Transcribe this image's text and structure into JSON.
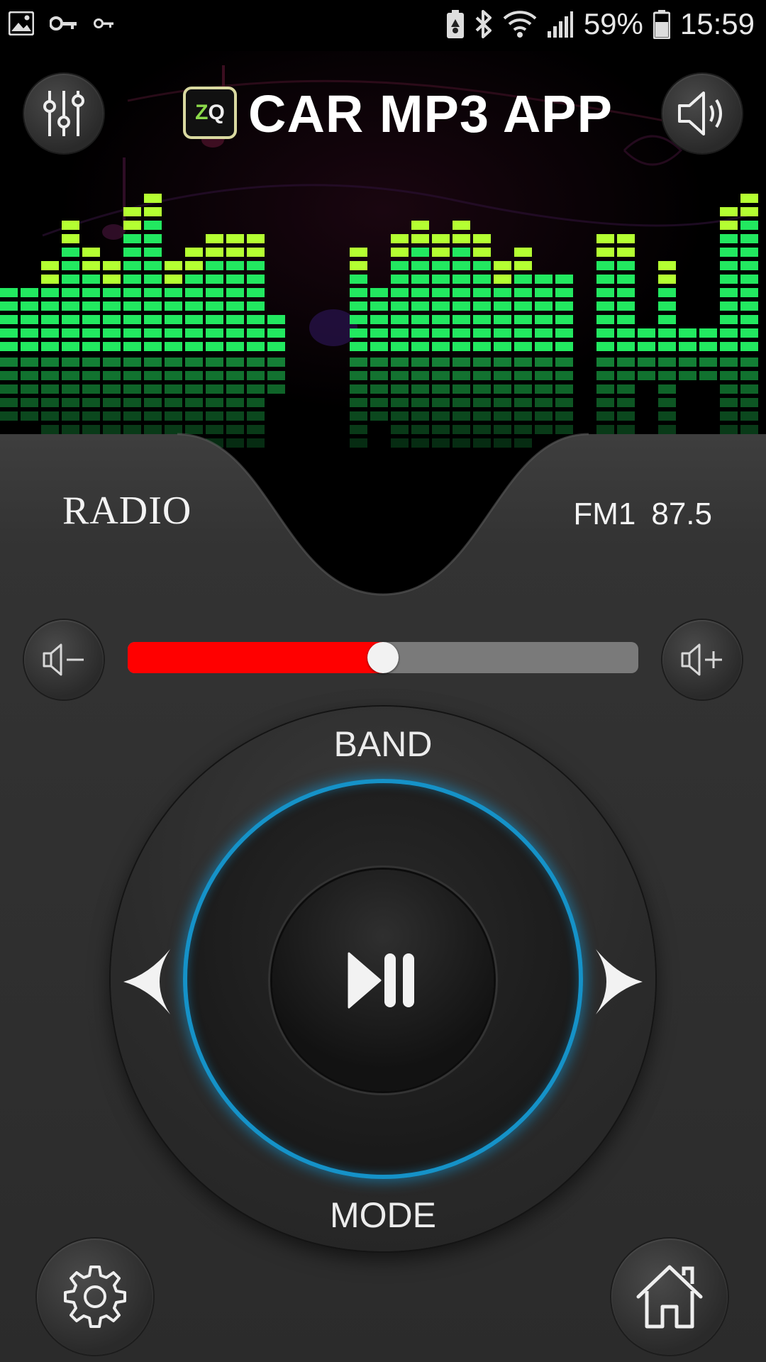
{
  "status_bar": {
    "battery_percent": "59%",
    "time": "15:59",
    "icons": [
      "image-icon",
      "key-icon",
      "key-small-icon",
      "battery-saver-icon",
      "bluetooth-icon",
      "wifi-icon",
      "signal-icon",
      "battery-icon"
    ]
  },
  "header": {
    "logo_z": "Z",
    "logo_q": "Q",
    "title": "CAR MP3 APP",
    "left_icon": "equalizer-icon",
    "right_icon": "speaker-icon"
  },
  "source": {
    "label": "RADIO",
    "band": "FM1",
    "frequency": "87.5"
  },
  "volume": {
    "level": 0.5,
    "down_icon": "volume-down-icon",
    "up_icon": "volume-up-icon"
  },
  "controls": {
    "band_label": "BAND",
    "mode_label": "MODE",
    "play_pause_icon": "play-pause-icon",
    "prev_icon": "prev-arrow-icon",
    "next_icon": "next-arrow-icon"
  },
  "bottom": {
    "settings_icon": "gear-icon",
    "home_icon": "home-icon"
  },
  "colors": {
    "accent_blue": "#1592c8",
    "volume_fill": "#ff0000",
    "spectrum_green": "#22e860",
    "spectrum_lime": "#b4ff32"
  },
  "spectrum": {
    "levels": [
      5,
      5,
      7,
      10,
      8,
      7,
      11,
      12,
      7,
      8,
      9,
      9,
      9,
      3,
      0,
      0,
      0,
      8,
      5,
      9,
      10,
      9,
      10,
      9,
      7,
      8,
      6,
      6,
      0,
      9,
      9,
      2,
      7,
      2,
      2,
      11,
      12
    ]
  }
}
